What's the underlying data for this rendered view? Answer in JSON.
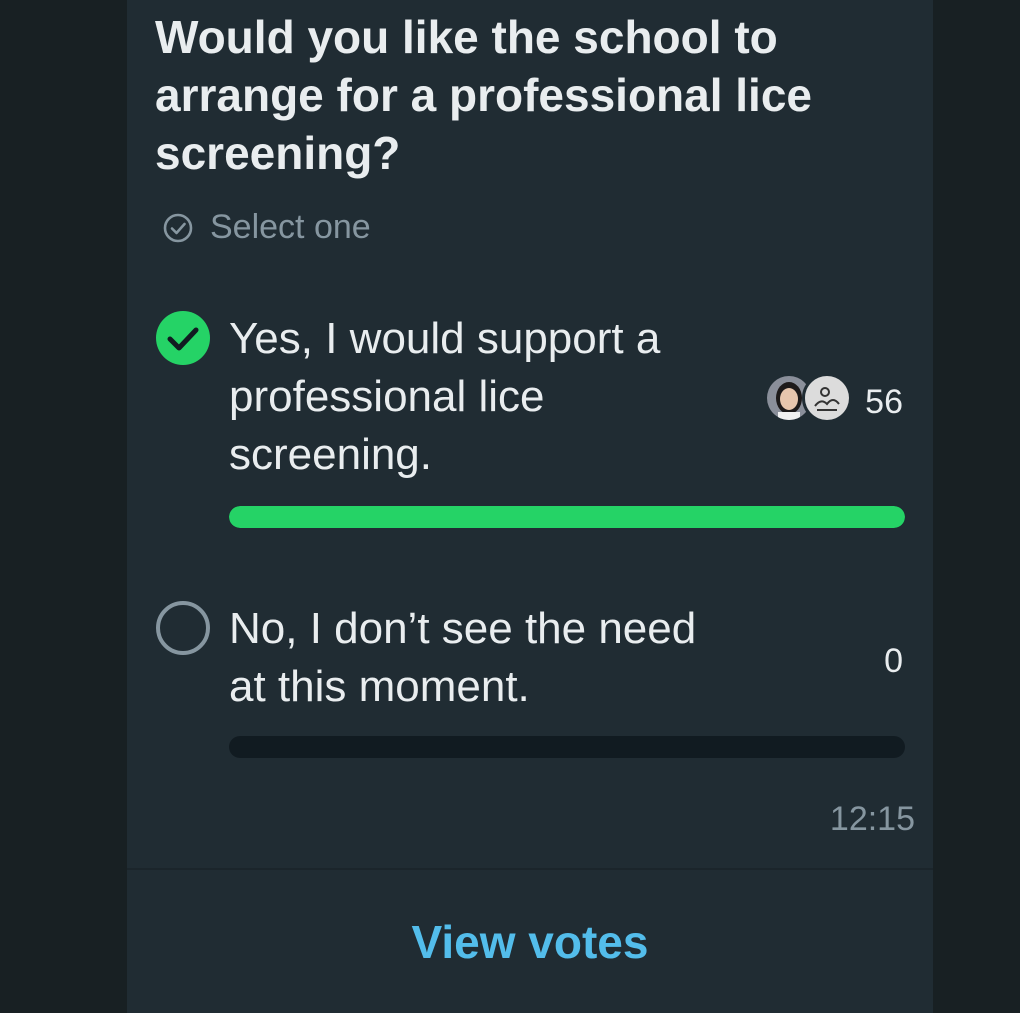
{
  "poll": {
    "question": "Would you like the school to arrange for a professional lice screening?",
    "select_hint": "Select one",
    "options": [
      {
        "text": "Yes, I would support a professional lice screening.",
        "count": "56",
        "selected": true,
        "vote_fraction": 1.0
      },
      {
        "text": "No, I don’t see the need at this moment.",
        "count": "0",
        "selected": false,
        "vote_fraction": 0.0
      }
    ],
    "timestamp": "12:15",
    "view_votes_label": "View votes"
  },
  "colors": {
    "background": "#182023",
    "card": "#202c33",
    "accent_green": "#25d366",
    "link_blue": "#53bdeb",
    "muted_text": "#8696a0",
    "primary_text": "#e9edef",
    "bar_track": "#111b21"
  },
  "icons": {
    "select_hint": "check-circle-outline-icon",
    "selected_option": "check-circle-filled-icon",
    "unselected_option": "radio-empty-icon"
  }
}
